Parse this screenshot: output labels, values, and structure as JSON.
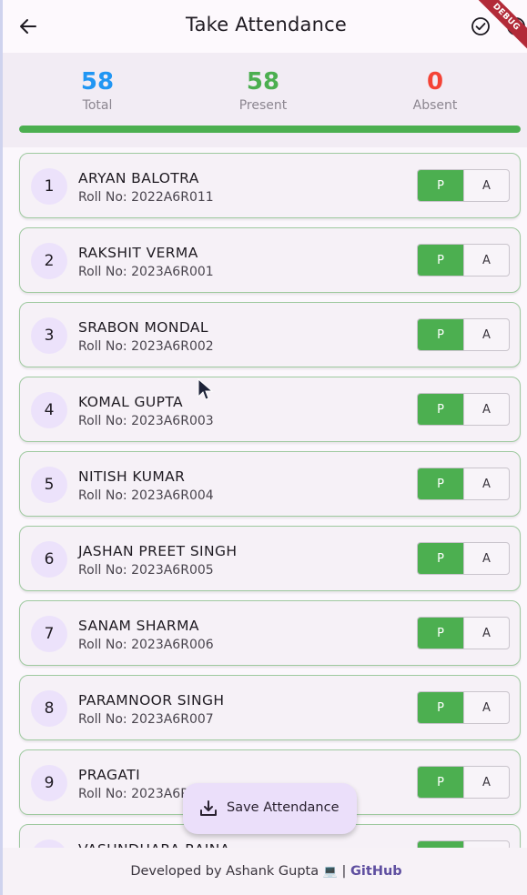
{
  "appbar": {
    "title": "Take Attendance",
    "back_icon": "arrow-left-icon",
    "confirm_icon": "check-circle-icon",
    "debug_label": "DEBUG"
  },
  "stats": {
    "total": {
      "value": "58",
      "label": "Total",
      "color": "#2196f3"
    },
    "present": {
      "value": "58",
      "label": "Present",
      "color": "#4caf50"
    },
    "absent": {
      "value": "0",
      "label": "Absent",
      "color": "#f44336"
    },
    "progress_fraction": 1.0
  },
  "toggle": {
    "present_label": "P",
    "absent_label": "A"
  },
  "students": [
    {
      "index": "1",
      "name": "ARYAN BALOTRA",
      "roll": "Roll No: 2022A6R011"
    },
    {
      "index": "2",
      "name": "RAKSHIT VERMA",
      "roll": "Roll No: 2023A6R001"
    },
    {
      "index": "3",
      "name": "SRABON MONDAL",
      "roll": "Roll No: 2023A6R002"
    },
    {
      "index": "4",
      "name": "KOMAL GUPTA",
      "roll": "Roll No: 2023A6R003"
    },
    {
      "index": "5",
      "name": "NITISH KUMAR",
      "roll": "Roll No: 2023A6R004"
    },
    {
      "index": "6",
      "name": "JASHAN PREET SINGH",
      "roll": "Roll No: 2023A6R005"
    },
    {
      "index": "7",
      "name": "SANAM SHARMA",
      "roll": "Roll No: 2023A6R006"
    },
    {
      "index": "8",
      "name": "PARAMNOOR SINGH",
      "roll": "Roll No: 2023A6R007"
    },
    {
      "index": "9",
      "name": "PRAGATI",
      "roll": "Roll No: 2023A6R"
    },
    {
      "index": "",
      "name": "VASUNDHARA RAINA",
      "roll": ""
    }
  ],
  "fab": {
    "label": "Save Attendance",
    "icon": "download-icon"
  },
  "footer": {
    "text": "Developed by Ashank Gupta",
    "emoji": "💻",
    "separator": "|",
    "link_label": "GitHub"
  }
}
